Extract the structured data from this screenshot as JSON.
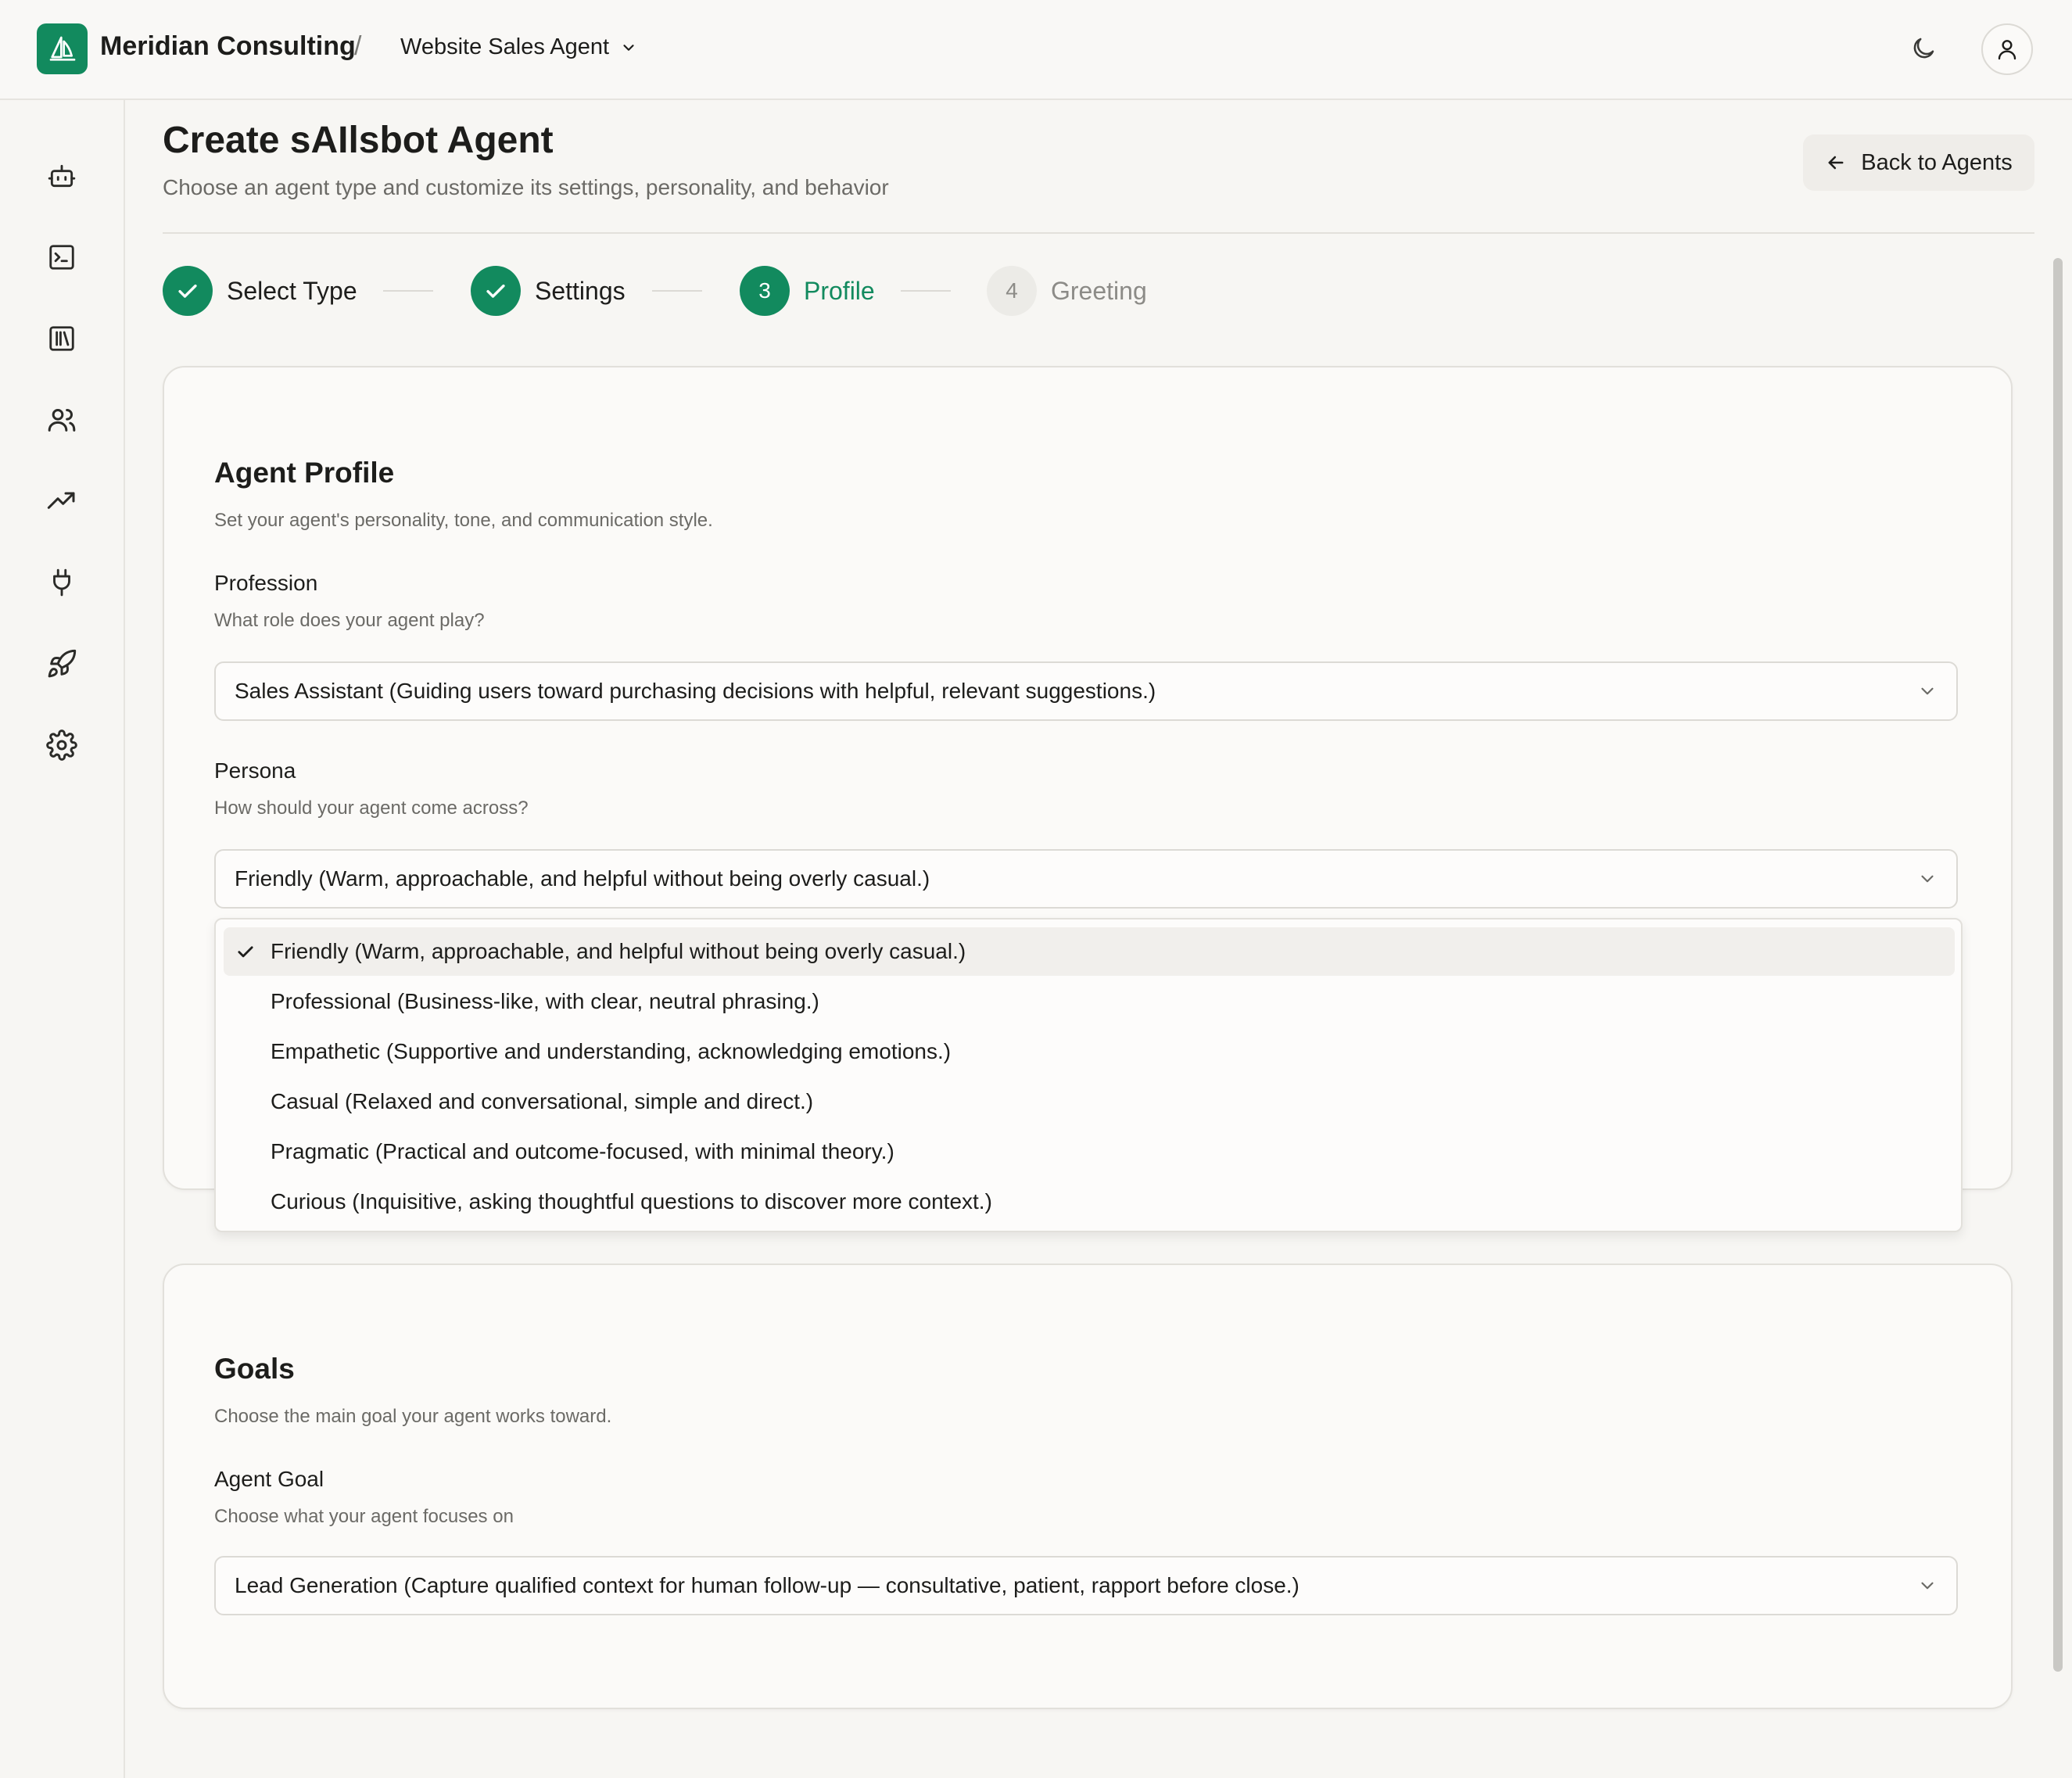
{
  "header": {
    "org_name": "Meridian Consulting",
    "separator": "/",
    "agent_name": "Website Sales Agent",
    "brand_color": "#128a5e"
  },
  "sidebar": {
    "items": [
      {
        "icon": "bot-icon"
      },
      {
        "icon": "terminal-icon"
      },
      {
        "icon": "library-icon"
      },
      {
        "icon": "users-icon"
      },
      {
        "icon": "trending-up-icon"
      },
      {
        "icon": "plug-icon"
      },
      {
        "icon": "rocket-icon"
      },
      {
        "icon": "settings-icon"
      }
    ]
  },
  "page": {
    "title": "Create sAIlsbot Agent",
    "subtitle": "Choose an agent type and customize its settings, personality, and behavior",
    "back_label": "Back to Agents"
  },
  "stepper": {
    "steps": [
      {
        "label": "Select Type",
        "status": "done"
      },
      {
        "label": "Settings",
        "status": "done"
      },
      {
        "number": "3",
        "label": "Profile",
        "status": "current"
      },
      {
        "number": "4",
        "label": "Greeting",
        "status": "todo"
      }
    ]
  },
  "profile_card": {
    "title": "Agent Profile",
    "description": "Set your agent's personality, tone, and communication style.",
    "profession": {
      "label": "Profession",
      "help": "What role does your agent play?",
      "value": "Sales Assistant (Guiding users toward purchasing decisions with helpful, relevant suggestions.)"
    },
    "persona": {
      "label": "Persona",
      "help": "How should your agent come across?",
      "value": "Friendly (Warm, approachable, and helpful without being overly casual.)",
      "options": [
        "Friendly (Warm, approachable, and helpful without being overly casual.)",
        "Professional (Business-like, with clear, neutral phrasing.)",
        "Empathetic (Supportive and understanding, acknowledging emotions.)",
        "Casual (Relaxed and conversational, simple and direct.)",
        "Pragmatic (Practical and outcome-focused, with minimal theory.)",
        "Curious (Inquisitive, asking thoughtful questions to discover more context.)"
      ]
    }
  },
  "goals_card": {
    "title": "Goals",
    "description": "Choose the main goal your agent works toward.",
    "goal": {
      "label": "Agent Goal",
      "help": "Choose what your agent focuses on",
      "value": "Lead Generation (Capture qualified context for human follow-up — consultative, patient, rapport before close.)"
    }
  }
}
